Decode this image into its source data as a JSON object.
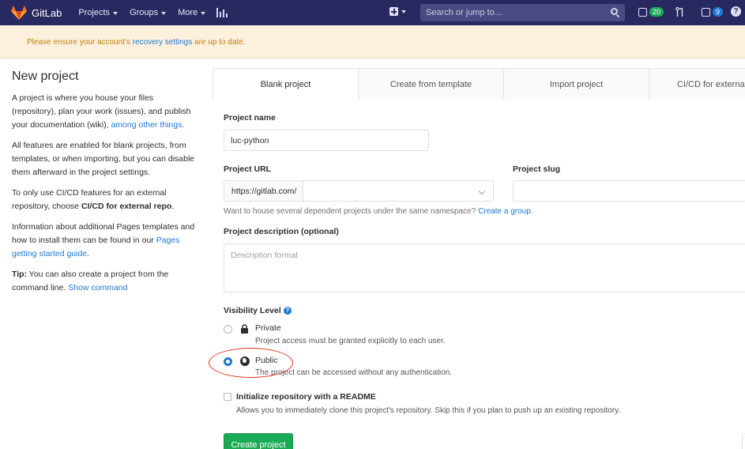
{
  "navbar": {
    "brand": "GitLab",
    "projects": "Projects",
    "groups": "Groups",
    "more": "More",
    "search_placeholder": "Search or jump to…",
    "issues_count": "20",
    "todos_count": "9",
    "help": "?"
  },
  "alert": {
    "text_before": "Please ensure your account's ",
    "link": "recovery settings",
    "text_after": " are up to date."
  },
  "sidebar": {
    "title": "New project",
    "p1_text": "A project is where you house your files (repository), plan your work (issues), and publish your documentation (wiki), ",
    "p1_link": "among other things",
    "p1_end": ".",
    "p2": "All features are enabled for blank projects, from templates, or when importing, but you can disable them afterward in the project settings.",
    "p3_text": "To only use CI/CD features for an external repository, choose ",
    "p3_bold": "CI/CD for external repo",
    "p3_end": ".",
    "p4_text": "Information about additional Pages templates and how to install them can be found in our ",
    "p4_link": "Pages getting started guide",
    "p4_end": ".",
    "p5_bold": "Tip:",
    "p5_text": " You can also create a project from the command line. ",
    "p5_link": "Show command"
  },
  "tabs": [
    {
      "label": "Blank project",
      "active": true
    },
    {
      "label": "Create from template",
      "active": false
    },
    {
      "label": "Import project",
      "active": false
    },
    {
      "label": "CI/CD for external repo",
      "active": false
    }
  ],
  "form": {
    "project_name_label": "Project name",
    "project_name_value": "luc-python",
    "project_url_label": "Project URL",
    "project_url_prefix": "https://gitlab.com/",
    "project_slug_label": "Project slug",
    "project_slug_value": "",
    "namespace_help": "Want to house several dependent projects under the same namespace? ",
    "namespace_link": "Create a group.",
    "description_label": "Project description (optional)",
    "description_placeholder": "Description format",
    "visibility_label": "Visibility Level",
    "visibility_help": "?",
    "private_title": "Private",
    "private_desc": "Project access must be granted explicitly to each user.",
    "public_title": "Public",
    "public_desc": "The project can be accessed without any authentication.",
    "visibility_selected": "Public",
    "readme_label": "Initialize repository with a README",
    "readme_checked": false,
    "readme_desc": "Allows you to immediately clone this project's repository. Skip this if you plan to push up an existing repository.",
    "create_button": "Create project"
  },
  "colors": {
    "navbar": "#292961",
    "accent_link": "#1f78d1",
    "create_button": "#1aaa55",
    "alert_bg": "#fdf1dd",
    "annotation_circle": "#e0301e"
  }
}
